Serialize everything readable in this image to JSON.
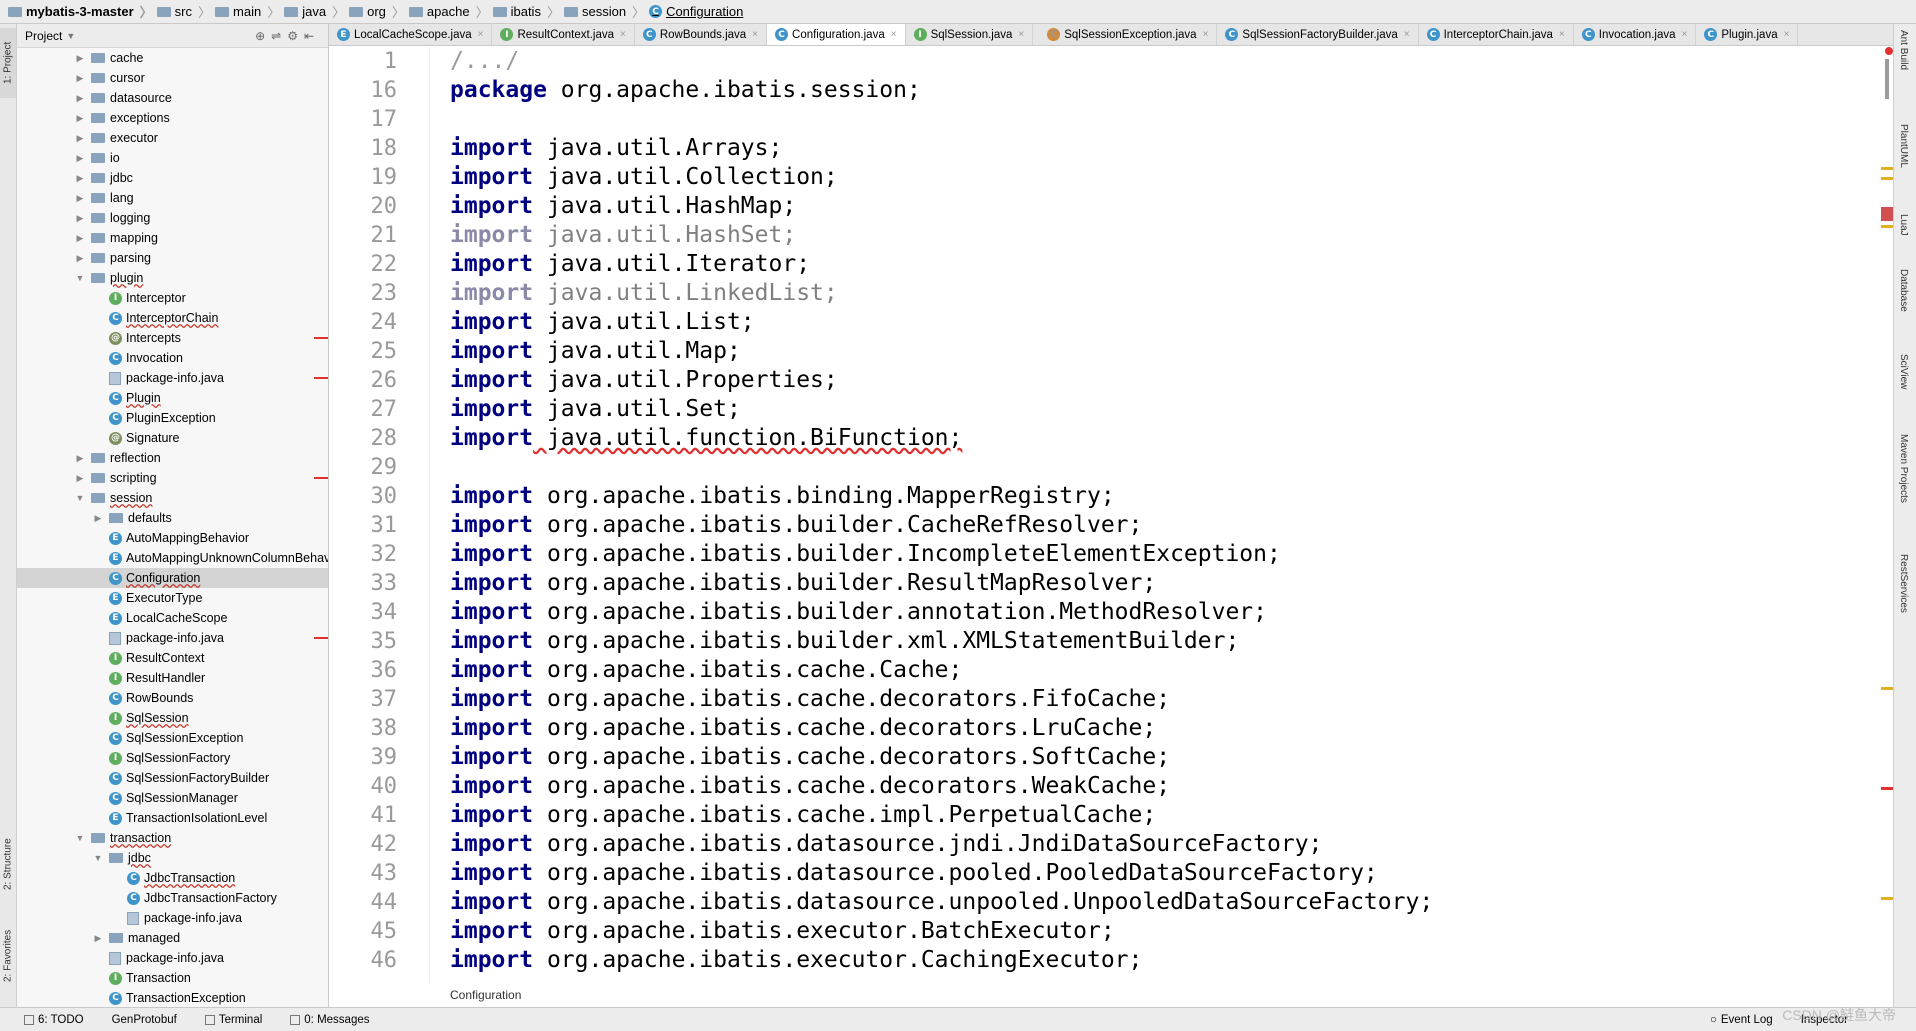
{
  "breadcrumb": [
    "mybatis-3-master",
    "src",
    "main",
    "java",
    "org",
    "apache",
    "ibatis",
    "session",
    "Configuration"
  ],
  "project_panel": {
    "title": "Project",
    "items": [
      {
        "label": "cache",
        "kind": "dir",
        "depth": 1,
        "state": "collapsed"
      },
      {
        "label": "cursor",
        "kind": "dir",
        "depth": 1,
        "state": "collapsed"
      },
      {
        "label": "datasource",
        "kind": "dir",
        "depth": 1,
        "state": "collapsed"
      },
      {
        "label": "exceptions",
        "kind": "dir",
        "depth": 1,
        "state": "collapsed"
      },
      {
        "label": "executor",
        "kind": "dir",
        "depth": 1,
        "state": "collapsed"
      },
      {
        "label": "io",
        "kind": "dir",
        "depth": 1,
        "state": "collapsed"
      },
      {
        "label": "jdbc",
        "kind": "dir",
        "depth": 1,
        "state": "collapsed"
      },
      {
        "label": "lang",
        "kind": "dir",
        "depth": 1,
        "state": "collapsed"
      },
      {
        "label": "logging",
        "kind": "dir",
        "depth": 1,
        "state": "collapsed"
      },
      {
        "label": "mapping",
        "kind": "dir",
        "depth": 1,
        "state": "collapsed"
      },
      {
        "label": "parsing",
        "kind": "dir",
        "depth": 1,
        "state": "collapsed"
      },
      {
        "label": "plugin",
        "kind": "dir",
        "depth": 1,
        "state": "expanded",
        "underline": true
      },
      {
        "label": "Interceptor",
        "kind": "i",
        "depth": 2
      },
      {
        "label": "InterceptorChain",
        "kind": "c",
        "depth": 2,
        "underline": true
      },
      {
        "label": "Intercepts",
        "kind": "a",
        "depth": 2,
        "mark": true
      },
      {
        "label": "Invocation",
        "kind": "c",
        "depth": 2
      },
      {
        "label": "package-info.java",
        "kind": "file",
        "depth": 2,
        "mark": true
      },
      {
        "label": "Plugin",
        "kind": "c",
        "depth": 2,
        "underline": true
      },
      {
        "label": "PluginException",
        "kind": "c",
        "depth": 2
      },
      {
        "label": "Signature",
        "kind": "a",
        "depth": 2
      },
      {
        "label": "reflection",
        "kind": "dir",
        "depth": 1,
        "state": "collapsed"
      },
      {
        "label": "scripting",
        "kind": "dir",
        "depth": 1,
        "state": "collapsed",
        "mark": true
      },
      {
        "label": "session",
        "kind": "dir",
        "depth": 1,
        "state": "expanded",
        "underline": true
      },
      {
        "label": "defaults",
        "kind": "dir",
        "depth": 2,
        "state": "collapsed"
      },
      {
        "label": "AutoMappingBehavior",
        "kind": "e",
        "depth": 2
      },
      {
        "label": "AutoMappingUnknownColumnBehavior",
        "kind": "e",
        "depth": 2
      },
      {
        "label": "Configuration",
        "kind": "c",
        "depth": 2,
        "selected": true,
        "underline": true
      },
      {
        "label": "ExecutorType",
        "kind": "e",
        "depth": 2
      },
      {
        "label": "LocalCacheScope",
        "kind": "e",
        "depth": 2
      },
      {
        "label": "package-info.java",
        "kind": "file",
        "depth": 2,
        "mark": true
      },
      {
        "label": "ResultContext",
        "kind": "i",
        "depth": 2
      },
      {
        "label": "ResultHandler",
        "kind": "i",
        "depth": 2
      },
      {
        "label": "RowBounds",
        "kind": "c",
        "depth": 2
      },
      {
        "label": "SqlSession",
        "kind": "i",
        "depth": 2,
        "underline": true
      },
      {
        "label": "SqlSessionException",
        "kind": "c",
        "depth": 2
      },
      {
        "label": "SqlSessionFactory",
        "kind": "i",
        "depth": 2
      },
      {
        "label": "SqlSessionFactoryBuilder",
        "kind": "c",
        "depth": 2
      },
      {
        "label": "SqlSessionManager",
        "kind": "c",
        "depth": 2
      },
      {
        "label": "TransactionIsolationLevel",
        "kind": "e",
        "depth": 2
      },
      {
        "label": "transaction",
        "kind": "dir",
        "depth": 1,
        "state": "expanded",
        "underline": true
      },
      {
        "label": "jdbc",
        "kind": "dir",
        "depth": 2,
        "state": "expanded",
        "underline": true
      },
      {
        "label": "JdbcTransaction",
        "kind": "c",
        "depth": 3,
        "underline": true
      },
      {
        "label": "JdbcTransactionFactory",
        "kind": "c",
        "depth": 3
      },
      {
        "label": "package-info.java",
        "kind": "file",
        "depth": 3
      },
      {
        "label": "managed",
        "kind": "dir",
        "depth": 2,
        "state": "collapsed"
      },
      {
        "label": "package-info.java",
        "kind": "file",
        "depth": 2
      },
      {
        "label": "Transaction",
        "kind": "i",
        "depth": 2
      },
      {
        "label": "TransactionException",
        "kind": "c",
        "depth": 2
      }
    ]
  },
  "tabs": [
    {
      "label": "LocalCacheScope.java",
      "kind": "e"
    },
    {
      "label": "ResultContext.java",
      "kind": "i"
    },
    {
      "label": "RowBounds.java",
      "kind": "c"
    },
    {
      "label": "Configuration.java",
      "kind": "c",
      "active": true
    },
    {
      "label": "SqlSession.java",
      "kind": "i"
    },
    {
      "label": "SqlSessionException.java",
      "kind": "x"
    },
    {
      "label": "SqlSessionFactoryBuilder.java",
      "kind": "c"
    },
    {
      "label": "InterceptorChain.java",
      "kind": "c"
    },
    {
      "label": "Invocation.java",
      "kind": "c"
    },
    {
      "label": "Plugin.java",
      "kind": "c"
    }
  ],
  "editor": {
    "lines": [
      {
        "no": "1",
        "kw": "",
        "text": "/.../",
        "style": "fold"
      },
      {
        "no": "16",
        "kw": "package",
        "text": " org.apache.ibatis.session;"
      },
      {
        "no": "17",
        "kw": "",
        "text": ""
      },
      {
        "no": "18",
        "kw": "import",
        "text": " java.util.Arrays;"
      },
      {
        "no": "19",
        "kw": "import",
        "text": " java.util.Collection;"
      },
      {
        "no": "20",
        "kw": "import",
        "text": " java.util.HashMap;"
      },
      {
        "no": "21",
        "kw": "import",
        "text": " java.util.HashSet;",
        "style": "dim"
      },
      {
        "no": "22",
        "kw": "import",
        "text": " java.util.Iterator;"
      },
      {
        "no": "23",
        "kw": "import",
        "text": " java.util.LinkedList;",
        "style": "dim"
      },
      {
        "no": "24",
        "kw": "import",
        "text": " java.util.List;"
      },
      {
        "no": "25",
        "kw": "import",
        "text": " java.util.Map;"
      },
      {
        "no": "26",
        "kw": "import",
        "text": " java.util.Properties;"
      },
      {
        "no": "27",
        "kw": "import",
        "text": " java.util.Set;"
      },
      {
        "no": "28",
        "kw": "import",
        "text": " java.util.function.BiFunction;",
        "style": "err"
      },
      {
        "no": "29",
        "kw": "",
        "text": ""
      },
      {
        "no": "30",
        "kw": "import",
        "text": " org.apache.ibatis.binding.MapperRegistry;"
      },
      {
        "no": "31",
        "kw": "import",
        "text": " org.apache.ibatis.builder.CacheRefResolver;"
      },
      {
        "no": "32",
        "kw": "import",
        "text": " org.apache.ibatis.builder.IncompleteElementException;"
      },
      {
        "no": "33",
        "kw": "import",
        "text": " org.apache.ibatis.builder.ResultMapResolver;"
      },
      {
        "no": "34",
        "kw": "import",
        "text": " org.apache.ibatis.builder.annotation.MethodResolver;"
      },
      {
        "no": "35",
        "kw": "import",
        "text": " org.apache.ibatis.builder.xml.XMLStatementBuilder;"
      },
      {
        "no": "36",
        "kw": "import",
        "text": " org.apache.ibatis.cache.Cache;"
      },
      {
        "no": "37",
        "kw": "import",
        "text": " org.apache.ibatis.cache.decorators.FifoCache;"
      },
      {
        "no": "38",
        "kw": "import",
        "text": " org.apache.ibatis.cache.decorators.LruCache;"
      },
      {
        "no": "39",
        "kw": "import",
        "text": " org.apache.ibatis.cache.decorators.SoftCache;"
      },
      {
        "no": "40",
        "kw": "import",
        "text": " org.apache.ibatis.cache.decorators.WeakCache;"
      },
      {
        "no": "41",
        "kw": "import",
        "text": " org.apache.ibatis.cache.impl.PerpetualCache;"
      },
      {
        "no": "42",
        "kw": "import",
        "text": " org.apache.ibatis.datasource.jndi.JndiDataSourceFactory;"
      },
      {
        "no": "43",
        "kw": "import",
        "text": " org.apache.ibatis.datasource.pooled.PooledDataSourceFactory;"
      },
      {
        "no": "44",
        "kw": "import",
        "text": " org.apache.ibatis.datasource.unpooled.UnpooledDataSourceFactory;"
      },
      {
        "no": "45",
        "kw": "import",
        "text": " org.apache.ibatis.executor.BatchExecutor;"
      },
      {
        "no": "46",
        "kw": "import",
        "text": " org.apache.ibatis.executor.CachingExecutor;"
      }
    ],
    "footer_breadcrumb": "Configuration"
  },
  "left_tool_windows": [
    "1: Project",
    "2: Structure",
    "2: Favorites"
  ],
  "right_tool_windows": [
    "Ant Build",
    "PlantUML",
    "LuaJ",
    "Database",
    "SciView",
    "Maven Projects",
    "RestServices"
  ],
  "status_bar": {
    "items": [
      "6: TODO",
      "GenProtobuf",
      "Terminal",
      "0: Messages"
    ],
    "right_items": [
      "Event Log",
      "Inspector"
    ],
    "watermark": "CSDN @鲢鱼大帝"
  },
  "colors": {
    "keyword": "#000080",
    "selection": "#d4d4d4",
    "error": "#e03030",
    "class_icon": "#3f94c9",
    "interface_icon": "#5eae5e"
  }
}
